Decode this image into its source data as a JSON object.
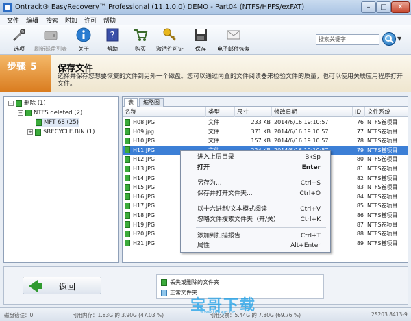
{
  "window": {
    "title": "Ontrack® EasyRecovery™ Professional (11.1.0.0) DEMO - Part04 (NTFS/HPFS/exFAT)",
    "min": "–",
    "max": "□",
    "close": "✕"
  },
  "menu": [
    "文件",
    "编辑",
    "搜索",
    "附加",
    "许可",
    "帮助"
  ],
  "toolbar": [
    {
      "label": "选项",
      "icon": "tools-icon",
      "enabled": true
    },
    {
      "label": "刷新磁盘列表",
      "icon": "refresh-disk-icon",
      "enabled": false
    },
    {
      "label": "关于",
      "icon": "info-icon",
      "enabled": true
    },
    {
      "label": "帮助",
      "icon": "help-icon",
      "enabled": true
    },
    {
      "label": "购买",
      "icon": "cart-icon",
      "enabled": true
    },
    {
      "label": "激活许可证",
      "icon": "key-icon",
      "enabled": true
    },
    {
      "label": "保存",
      "icon": "save-icon",
      "enabled": true
    },
    {
      "label": "电子邮件恢复",
      "icon": "mail-icon",
      "enabled": true
    }
  ],
  "search": {
    "placeholder": "搜索关键字",
    "dropdown": "▼"
  },
  "step": {
    "label": "步骤",
    "number": "5",
    "title": "保存文件",
    "description": "选择并保存您想要恢复的文件到另外一个磁盘。您可以通过内置的文件阅读器来检验文件的质量，也可以使用关联应用程序打开文件。"
  },
  "tree": [
    {
      "label": "删除 (1)",
      "expander": "−",
      "level": 0
    },
    {
      "label": "NTFS deleted (2)",
      "expander": "−",
      "level": 1
    },
    {
      "label": "MFT 68 (25)",
      "expander": "",
      "level": 2
    },
    {
      "label": "$RECYCLE.BIN (1)",
      "expander": "+",
      "level": 2
    }
  ],
  "tabs": [
    "表",
    "缩略图"
  ],
  "columns": [
    "名称",
    "类型",
    "尺寸",
    "修改日期",
    "ID",
    "文件系统"
  ],
  "files": [
    {
      "name": "H08.JPG",
      "type": "文件",
      "size": "233 KB",
      "date": "2014/6/16 19:10:57",
      "id": "76",
      "fs": "NTFS卷项目"
    },
    {
      "name": "H09.jpg",
      "type": "文件",
      "size": "371 KB",
      "date": "2014/6/16 19:10:57",
      "id": "77",
      "fs": "NTFS卷项目"
    },
    {
      "name": "H10.JPG",
      "type": "文件",
      "size": "157 KB",
      "date": "2014/6/16 19:10:57",
      "id": "78",
      "fs": "NTFS卷项目"
    },
    {
      "name": "H11.JPG",
      "type": "文件",
      "size": "224 KB",
      "date": "2014/6/16 19:10:57",
      "id": "79",
      "fs": "NTFS卷项目"
    },
    {
      "name": "H12.JPG",
      "type": "",
      "size": "",
      "date": "",
      "id": "80",
      "fs": "NTFS卷项目"
    },
    {
      "name": "H13.JPG",
      "type": "",
      "size": "",
      "date": "",
      "id": "81",
      "fs": "NTFS卷项目"
    },
    {
      "name": "H14.JPG",
      "type": "",
      "size": "",
      "date": "",
      "id": "82",
      "fs": "NTFS卷项目"
    },
    {
      "name": "H15.JPG",
      "type": "",
      "size": "",
      "date": "",
      "id": "83",
      "fs": "NTFS卷项目"
    },
    {
      "name": "H16.JPG",
      "type": "",
      "size": "",
      "date": "",
      "id": "84",
      "fs": "NTFS卷项目"
    },
    {
      "name": "H17.JPG",
      "type": "",
      "size": "",
      "date": "",
      "id": "85",
      "fs": "NTFS卷项目"
    },
    {
      "name": "H18.JPG",
      "type": "",
      "size": "",
      "date": "",
      "id": "86",
      "fs": "NTFS卷项目"
    },
    {
      "name": "H19.JPG",
      "type": "",
      "size": "",
      "date": "",
      "id": "87",
      "fs": "NTFS卷项目"
    },
    {
      "name": "H20.JPG",
      "type": "",
      "size": "",
      "date": "",
      "id": "88",
      "fs": "NTFS卷项目"
    },
    {
      "name": "H21.JPG",
      "type": "",
      "size": "",
      "date": "",
      "id": "89",
      "fs": "NTFS卷项目"
    }
  ],
  "context_menu": [
    {
      "label": "进入上层目录",
      "shortcut": "BkSp",
      "bold": false
    },
    {
      "label": "打开",
      "shortcut": "Enter",
      "bold": true
    },
    {
      "sep": true
    },
    {
      "label": "另存为...",
      "shortcut": "Ctrl+S",
      "bold": false
    },
    {
      "label": "保存并打开文件夹...",
      "shortcut": "Ctrl+O",
      "bold": false
    },
    {
      "sep": true
    },
    {
      "label": "以十六进制/文本模式阅读",
      "shortcut": "Ctrl+V",
      "bold": false
    },
    {
      "label": "忽略文件搜索文件夹（开/关）",
      "shortcut": "Ctrl+K",
      "bold": false
    },
    {
      "sep": true
    },
    {
      "label": "添加到扫描报告",
      "shortcut": "Ctrl+T",
      "bold": false
    },
    {
      "label": "属性",
      "shortcut": "Alt+Enter",
      "bold": false
    }
  ],
  "back_button": "返回",
  "legend": [
    "丢失或删除的文件夹",
    "正常文件夹"
  ],
  "status": {
    "disk_errors": "磁盘错误：0",
    "memory": "可用内存：1.83G 的 3.90G (47.03 %)",
    "swap": "可用交换：5.44G 的 7.80G (69.76 %)",
    "code": "2S203.8413-9"
  },
  "watermark": {
    "text": "宝哥下载",
    "url": "www.baoge.net"
  },
  "colors": {
    "accent": "#3c7fd6",
    "step_orange": "#e08a2c",
    "file_green": "#3bab3b"
  }
}
